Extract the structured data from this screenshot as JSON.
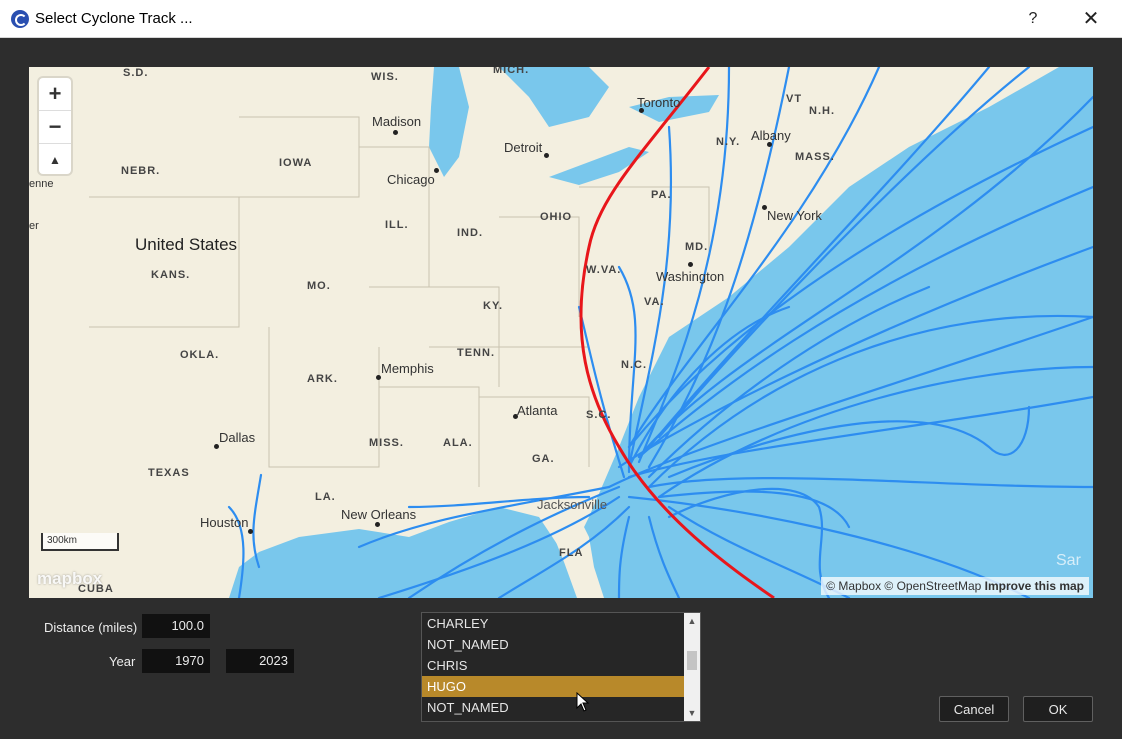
{
  "window": {
    "title": "Select Cyclone Track ...",
    "help": "?",
    "close": "✕"
  },
  "map": {
    "states": [
      "S.D.",
      "WIS.",
      "MICH.",
      "NEBR.",
      "IOWA",
      "ILL.",
      "IND.",
      "OHIO",
      "PA.",
      "N.Y.",
      "VT",
      "N.H.",
      "MASS.",
      "KANS.",
      "MO.",
      "KY.",
      "W.VA.",
      "VA.",
      "MD.",
      "OKLA.",
      "ARK.",
      "TENN.",
      "N.C.",
      "S.C.",
      "TEXAS",
      "MISS.",
      "ALA.",
      "GA.",
      "LA.",
      "FLA",
      "CUBA"
    ],
    "cities": [
      "Toronto",
      "Madison",
      "Detroit",
      "Chicago",
      "Albany",
      "New York",
      "Washington",
      "Memphis",
      "Atlanta",
      "Dallas",
      "Houston",
      "New Orleans",
      "Jacksonville"
    ],
    "country": "United States",
    "partial_labels": [
      "enne",
      "er",
      "Sar"
    ],
    "scale": "300km",
    "logo": "mapbox",
    "attribution": "© Mapbox © OpenStreetMap",
    "improve": "Improve this map",
    "zoom_in": "+",
    "zoom_out": "−",
    "compass": "▲",
    "colors": {
      "water": "#79c7ec",
      "land": "#f3efe0",
      "tracks": "#2d8df0",
      "selected_track": "#e8161b"
    }
  },
  "form": {
    "distance_label": "Distance (miles)",
    "distance_value": "100.0",
    "year_label": "Year",
    "year_from": "1970",
    "year_to": "2023"
  },
  "storms": {
    "items": [
      "CHARLEY",
      "NOT_NAMED",
      "CHRIS",
      "HUGO",
      "NOT_NAMED"
    ],
    "selected": "HUGO"
  },
  "buttons": {
    "cancel": "Cancel",
    "ok": "OK"
  }
}
